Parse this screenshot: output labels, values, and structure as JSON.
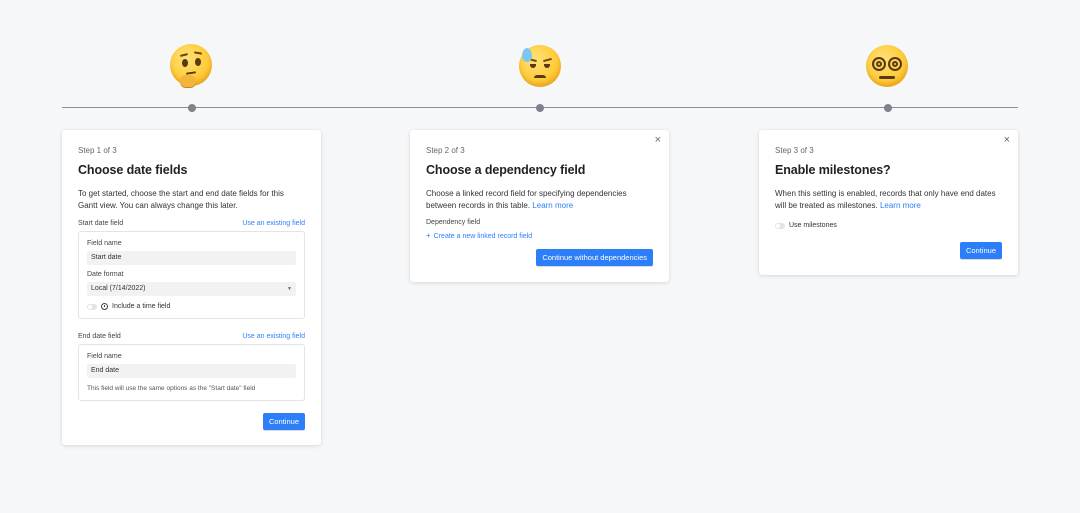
{
  "steps": [
    {
      "emoji_icon": "thinking-face-icon",
      "step_label": "Step 1 of 3",
      "title": "Choose date fields",
      "description": "To get started, choose the start and end date fields for this Gantt view. You can always change this later.",
      "start": {
        "section_label": "Start date field",
        "existing_link": "Use an existing field",
        "field_name_label": "Field name",
        "field_name_value": "Start date",
        "date_format_label": "Date format",
        "date_format_value": "Local (7/14/2022)",
        "time_toggle_label": "Include a time field"
      },
      "end": {
        "section_label": "End date field",
        "existing_link": "Use an existing field",
        "field_name_label": "Field name",
        "field_name_value": "End date",
        "note": "This field will use the same options as the \"Start date\" field"
      },
      "continue_label": "Continue"
    },
    {
      "emoji_icon": "downcast-face-with-sweat-icon",
      "close_glyph": "×",
      "step_label": "Step 2 of 3",
      "title": "Choose a dependency field",
      "description": "Choose a linked record field for specifying dependencies between records in this table.",
      "learn_more": "Learn more",
      "field_label": "Dependency field",
      "create_link": "Create a new linked record field",
      "continue_label": "Continue without dependencies"
    },
    {
      "emoji_icon": "face-with-spiral-eyes-icon",
      "close_glyph": "×",
      "step_label": "Step 3 of 3",
      "title": "Enable milestones?",
      "description": "When this setting is enabled, records that only have end dates will be treated as milestones.",
      "learn_more": "Learn more",
      "toggle_label": "Use milestones",
      "continue_label": "Continue"
    }
  ]
}
